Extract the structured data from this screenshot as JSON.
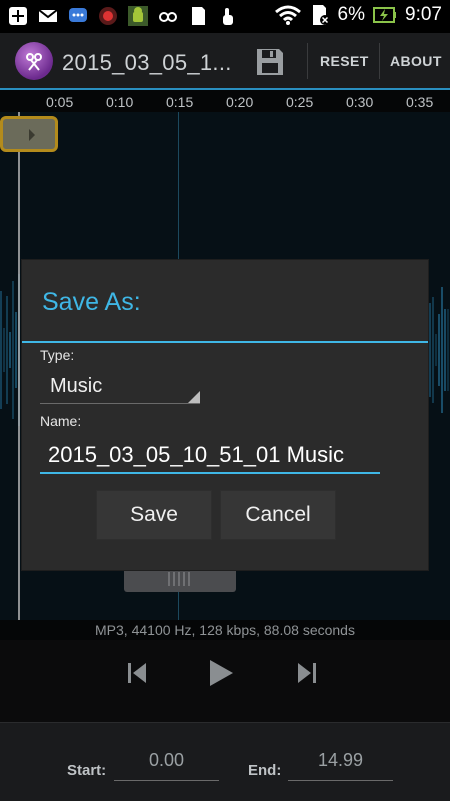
{
  "status": {
    "battery": "6%",
    "time": "9:07",
    "icons": [
      "plus-icon",
      "mail-icon",
      "chat-icon",
      "stop-icon",
      "android-icon",
      "glasses-icon",
      "sd-card-icon",
      "touch-icon",
      "wifi-icon",
      "battery-charging-icon"
    ]
  },
  "actionbar": {
    "title": "2015_03_05_1...",
    "reset_label": "RESET",
    "about_label": "ABOUT"
  },
  "timeline": {
    "ticks": [
      "0:05",
      "0:10",
      "0:15",
      "0:20",
      "0:25",
      "0:30",
      "0:35"
    ]
  },
  "dialog": {
    "title": "Save As:",
    "type_label": "Type:",
    "type_value": "Music",
    "name_label": "Name:",
    "name_value": "2015_03_05_10_51_01 Music",
    "save_label": "Save",
    "cancel_label": "Cancel"
  },
  "info": {
    "text": "MP3, 44100 Hz, 128 kbps, 88.08 seconds"
  },
  "bottom": {
    "start_label": "Start:",
    "start_value": "0.00",
    "end_label": "End:",
    "end_value": "14.99"
  },
  "colors": {
    "accent": "#3fb7e6",
    "marker": "#b38b1c"
  }
}
